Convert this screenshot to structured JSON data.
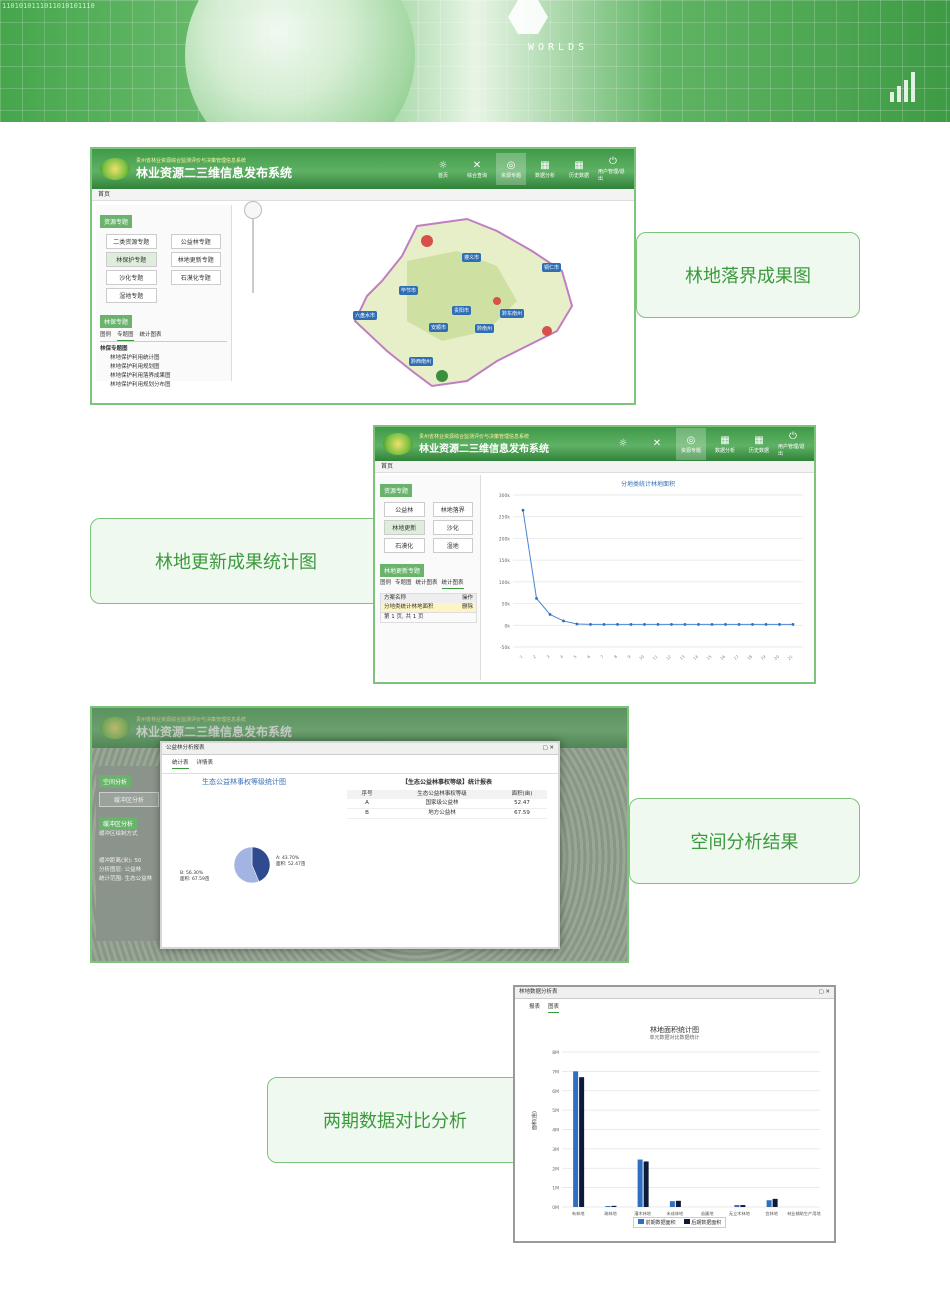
{
  "banner": {
    "brand": "WORLDS",
    "code_text": "1101010111011010101110"
  },
  "app": {
    "subtitle": "贵州省林业资源综合监测评价与决策管理信息系统",
    "title": "林业资源二三维信息发布系统",
    "nav": [
      "首页",
      "综合查询",
      "资源专题",
      "数据分析",
      "历史数据",
      "用户管理/退出"
    ],
    "crumb": "首页"
  },
  "callouts": {
    "c1": "林地落界成果图",
    "c2": "林地更新成果统计图",
    "c3": "空间分析结果",
    "c4": "两期数据对比分析"
  },
  "shot1": {
    "panel_tag": "资源专题",
    "buttons": [
      "二类资源专题",
      "公益林专题",
      "林保护专题",
      "林地更新专题",
      "沙化专题",
      "石漠化专题",
      "湿地专题"
    ],
    "panel2_tag": "林保专题",
    "tabs": [
      "图例",
      "专题图",
      "统计图表"
    ],
    "tree_root": "林保专题图",
    "tree_items": [
      "林地保护利用统计图",
      "林地保护利用规划图",
      "林地保护利用落界成果图",
      "林地保护利用规划分布图"
    ],
    "cities": [
      "遵义市",
      "铜仁市",
      "毕节市",
      "六盘水市",
      "贵阳市",
      "安顺市",
      "黔南州",
      "黔东南州",
      "黔西南州"
    ]
  },
  "shot2": {
    "chart_title": "分地类统计林地面积",
    "panel_tag": "资源专题",
    "buttons": [
      "公益林",
      "林地落界",
      "林地更新",
      "沙化",
      "石漠化",
      "湿地"
    ],
    "panel2_tag": "林地更新专题",
    "tabs": [
      "图例",
      "专题图",
      "统计图表",
      "统计图表"
    ],
    "table_headers": [
      "方案名称",
      "操作"
    ],
    "table_row": [
      "分地类统计林地面积",
      "删除"
    ],
    "pager": "第 1 页, 共 1 页"
  },
  "shot3": {
    "dialog_title": "公益林分析报表",
    "tabs": [
      "统计表",
      "详情表"
    ],
    "pie_title": "生态公益林事权等级统计图",
    "table_title": "【生态公益林事权等级】统计报表",
    "table_headers": [
      "序号",
      "生态公益林事权等级",
      "面积(亩)"
    ],
    "rows": [
      [
        "A",
        "国家级公益林",
        "52.47"
      ],
      [
        "B",
        "地方公益林",
        "67.59"
      ]
    ],
    "left_tag1": "空间分析",
    "left_btn": "缓冲区分析",
    "left_tag2": "缓冲区分析",
    "left_lbl": "缓冲区绘制方式",
    "form_labels": [
      "缓冲距离(米):",
      "分析图层:",
      "统计范围:"
    ],
    "form_values": [
      "50",
      "公益林",
      "生态公益林"
    ],
    "slice_a_label": "A: 43.70%",
    "slice_a_area": "面积: 52.47亩",
    "slice_b_label": "B: 56.30%",
    "slice_b_area": "面积: 67.59亩"
  },
  "shot4": {
    "dialog_title": "林地数据分析表",
    "tabs": [
      "报表",
      "图表"
    ],
    "chart_title": "林地面积统计图",
    "chart_subtitle": "单元数据对比数据统计",
    "ylabel": "面积(亩)",
    "legend": [
      "前期数据面积",
      "后期数据面积"
    ]
  },
  "chart_data": [
    {
      "type": "line",
      "title": "分地类统计林地面积",
      "x": [
        "1",
        "2",
        "3",
        "4",
        "5",
        "6",
        "7",
        "8",
        "9",
        "10",
        "11",
        "12",
        "13",
        "14",
        "15",
        "16",
        "17",
        "18",
        "19",
        "20",
        "21"
      ],
      "y": [
        2.65,
        0.62,
        0.25,
        0.1,
        0.03,
        0.02,
        0.02,
        0.02,
        0.02,
        0.02,
        0.02,
        0.02,
        0.02,
        0.02,
        0.02,
        0.02,
        0.02,
        0.02,
        0.02,
        0.02,
        0.02
      ],
      "ylim": [
        -0.5,
        3.0
      ],
      "ytick_labels": [
        "-50k",
        "0k",
        "50k",
        "100k",
        "150k",
        "200k",
        "250k",
        "300k"
      ]
    },
    {
      "type": "pie",
      "title": "生态公益林事权等级统计图",
      "labels": [
        "A",
        "B"
      ],
      "values": [
        43.7,
        56.3
      ],
      "colors": [
        "#2f4a8f",
        "#a3b4e3"
      ]
    },
    {
      "type": "bar",
      "title": "林地面积统计图",
      "categories": [
        "有林地",
        "疏林地",
        "灌木林地",
        "未成林地",
        "苗圃地",
        "无立木林地",
        "宜林地",
        "林业辅助生产用地"
      ],
      "series": [
        {
          "name": "前期数据面积",
          "values": [
            7.0,
            0.05,
            2.45,
            0.3,
            0.0,
            0.1,
            0.35,
            0.0
          ],
          "color": "#2e6fc2"
        },
        {
          "name": "后期数据面积",
          "values": [
            6.7,
            0.06,
            2.35,
            0.32,
            0.0,
            0.1,
            0.42,
            0.0
          ],
          "color": "#0d1a3a"
        }
      ],
      "ylim": [
        0,
        8
      ],
      "ytick_labels": [
        "0M",
        "1M",
        "2M",
        "3M",
        "4M",
        "5M",
        "6M",
        "7M",
        "8M"
      ]
    }
  ]
}
